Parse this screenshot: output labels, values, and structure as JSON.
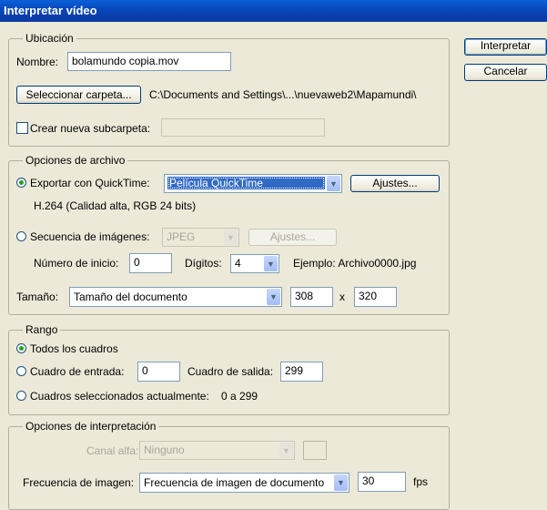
{
  "window": {
    "title": "Interpretar vídeo"
  },
  "buttons": {
    "render": "Interpretar",
    "cancel": "Cancelar"
  },
  "location": {
    "group_label": "Ubicación",
    "name_label": "Nombre:",
    "name_value": "bolamundo copia.mov",
    "select_folder_button": "Seleccionar carpeta...",
    "folder_path": "C:\\Documents and Settings\\...\\nuevaweb2\\Mapamundi\\",
    "new_subfolder_label": "Crear nueva subcarpeta:",
    "new_subfolder_checked": false,
    "new_subfolder_value": ""
  },
  "file_options": {
    "group_label": "Opciones de archivo",
    "quicktime_export_label": "Exportar con QuickTime:",
    "quicktime_export_selected": true,
    "quicktime_format": "Película QuickTime",
    "quicktime_settings_button": "Ajustes...",
    "quicktime_info": "H.264 (Calidad alta, RGB 24 bits)",
    "image_sequence_label": "Secuencia de imágenes:",
    "image_sequence_selected": false,
    "image_format": "JPEG",
    "image_settings_button": "Ajustes...",
    "start_number_label": "Número de inicio:",
    "start_number_value": "0",
    "digits_label": "Dígitos:",
    "digits_value": "4",
    "example_text": "Ejemplo: Archivo0000.jpg",
    "size_label": "Tamaño:",
    "size_value": "Tamaño del documento",
    "width_value": "308",
    "size_separator": "x",
    "height_value": "320"
  },
  "range": {
    "group_label": "Rango",
    "all_frames_label": "Todos los cuadros",
    "all_frames_selected": true,
    "in_frame_label": "Cuadro de entrada:",
    "in_frame_value": "0",
    "out_frame_label": "Cuadro de salida:",
    "out_frame_value": "299",
    "current_selection_label": "Cuadros seleccionados actualmente:",
    "current_selection_value": "0 a 299"
  },
  "render_options": {
    "group_label": "Opciones de interpretación",
    "alpha_label": "Canal alfa:",
    "alpha_value": "Ninguno",
    "frame_rate_label": "Frecuencia de imagen:",
    "frame_rate_value": "Frecuencia de imagen de documento",
    "fps_value": "30",
    "fps_unit": "fps"
  },
  "colors": {
    "dialog_bg": "#ece9d8",
    "titlebar": "#0a46c0",
    "selection": "#316ac5",
    "radio_dot": "#21a121"
  }
}
